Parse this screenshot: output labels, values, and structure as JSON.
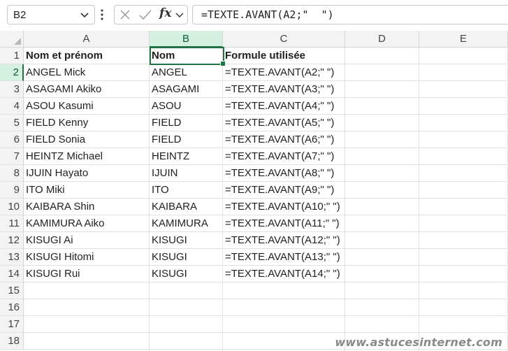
{
  "name_box": {
    "value": "B2"
  },
  "formula_bar": {
    "text": "=TEXTE.AVANT(A2;\"  \")",
    "fx_label": "fx"
  },
  "columns": [
    "A",
    "B",
    "C",
    "D",
    "E"
  ],
  "rows": [
    "1",
    "2",
    "3",
    "4",
    "5",
    "6",
    "7",
    "8",
    "9",
    "10",
    "11",
    "12",
    "13",
    "14",
    "15",
    "16",
    "17",
    "18"
  ],
  "headers": {
    "a": "Nom et prénom",
    "b": "Nom",
    "c": "Formule utilisée"
  },
  "data_rows": [
    {
      "a": "ANGEL Mick",
      "b": "ANGEL",
      "c": "=TEXTE.AVANT(A2;\" \")"
    },
    {
      "a": "ASAGAMI Akiko",
      "b": "ASAGAMI",
      "c": "=TEXTE.AVANT(A3;\" \")"
    },
    {
      "a": "ASOU Kasumi",
      "b": "ASOU",
      "c": "=TEXTE.AVANT(A4;\" \")"
    },
    {
      "a": "FIELD Kenny",
      "b": "FIELD",
      "c": "=TEXTE.AVANT(A5;\" \")"
    },
    {
      "a": "FIELD Sonia",
      "b": "FIELD",
      "c": "=TEXTE.AVANT(A6;\" \")"
    },
    {
      "a": "HEINTZ Michael",
      "b": "HEINTZ",
      "c": "=TEXTE.AVANT(A7;\" \")"
    },
    {
      "a": "IJUIN Hayato",
      "b": "IJUIN",
      "c": "=TEXTE.AVANT(A8;\" \")"
    },
    {
      "a": "ITO Miki",
      "b": "ITO",
      "c": "=TEXTE.AVANT(A9;\" \")"
    },
    {
      "a": "KAIBARA Shin",
      "b": "KAIBARA",
      "c": "=TEXTE.AVANT(A10;\" \")"
    },
    {
      "a": "KAMIMURA Aiko",
      "b": "KAMIMURA",
      "c": "=TEXTE.AVANT(A11;\" \")"
    },
    {
      "a": "KISUGI Ai",
      "b": "KISUGI",
      "c": "=TEXTE.AVANT(A12;\" \")"
    },
    {
      "a": "KISUGI Hitomi",
      "b": "KISUGI",
      "c": "=TEXTE.AVANT(A13;\" \")"
    },
    {
      "a": "KISUGI Rui",
      "b": "KISUGI",
      "c": "=TEXTE.AVANT(A14;\" \")"
    }
  ],
  "selection": {
    "column": "B",
    "row": "2"
  },
  "watermark": "www.astucesinternet.com",
  "colors": {
    "accent": "#217346",
    "selected_header_bg": "#d3f0e0",
    "header_bg": "#f3f3f3",
    "gridline": "#e1e1e1"
  },
  "icons": [
    "chevron-down-icon",
    "more-vertical-icon",
    "cancel-x-icon",
    "confirm-check-icon",
    "function-fx-icon",
    "chevron-down-icon"
  ]
}
